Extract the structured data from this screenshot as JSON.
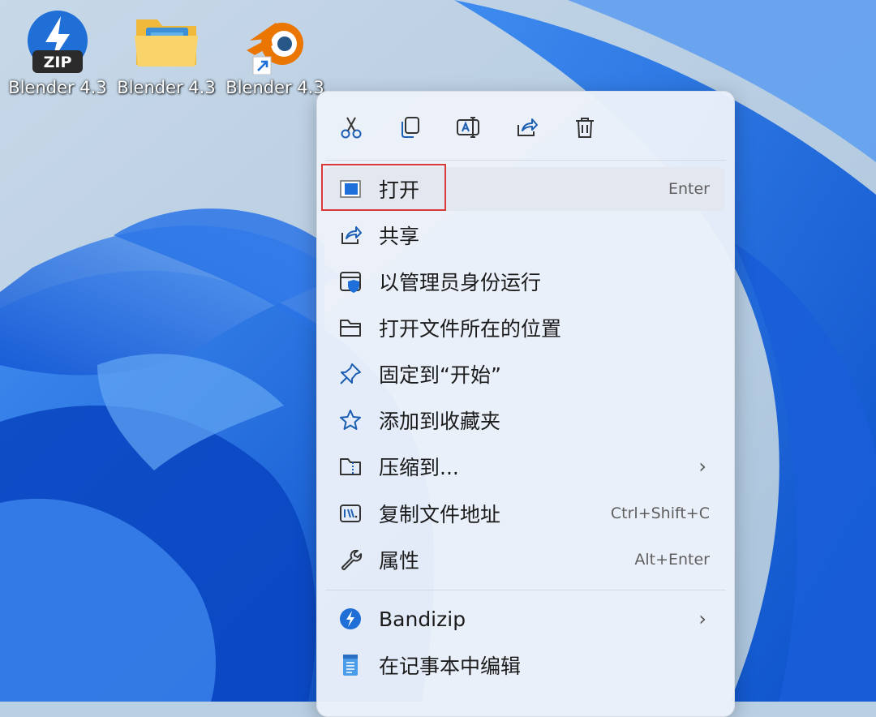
{
  "desktop": {
    "icons": [
      {
        "label": "Blender 4.3",
        "icon": "bandizip-zip-icon",
        "badge": "ZIP"
      },
      {
        "label": "Blender 4.3",
        "icon": "folder-icon"
      },
      {
        "label": "Blender 4.3",
        "icon": "blender-icon"
      }
    ]
  },
  "context_menu": {
    "quick_actions": [
      {
        "name": "cut",
        "icon": "scissors-icon"
      },
      {
        "name": "copy",
        "icon": "copy-icon"
      },
      {
        "name": "rename",
        "icon": "rename-icon"
      },
      {
        "name": "share",
        "icon": "share-icon"
      },
      {
        "name": "delete",
        "icon": "trash-icon"
      }
    ],
    "items": [
      {
        "label": "打开",
        "shortcut": "Enter",
        "icon": "open-app-icon"
      },
      {
        "label": "共享",
        "icon": "share-icon"
      },
      {
        "label": "以管理员身份运行",
        "icon": "admin-shield-icon"
      },
      {
        "label": "打开文件所在的位置",
        "icon": "folder-outline-icon"
      },
      {
        "label": "固定到“开始”",
        "icon": "pin-icon"
      },
      {
        "label": "添加到收藏夹",
        "icon": "star-icon"
      },
      {
        "label": "压缩到...",
        "icon": "zip-folder-icon",
        "submenu": true
      },
      {
        "label": "复制文件地址",
        "shortcut": "Ctrl+Shift+C",
        "icon": "copy-path-icon"
      },
      {
        "label": "属性",
        "shortcut": "Alt+Enter",
        "icon": "wrench-icon"
      },
      {
        "label": "Bandizip",
        "icon": "bandizip-icon",
        "submenu": true
      },
      {
        "label": "在记事本中编辑",
        "icon": "notepad-icon"
      }
    ],
    "submenu_glyph": "›"
  },
  "colors": {
    "highlight_border": "#d83a3a",
    "accent": "#1e6fd9",
    "menu_bg": "#ecf1fa"
  }
}
